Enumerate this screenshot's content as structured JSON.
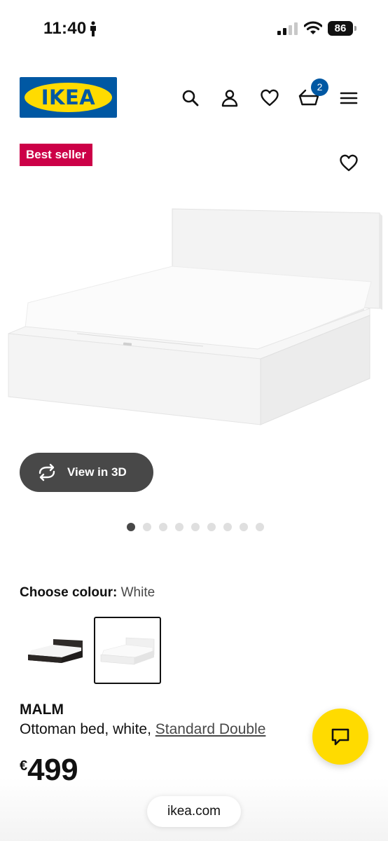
{
  "status_bar": {
    "time": "11:40",
    "battery": "86"
  },
  "header": {
    "logo_text": "IKEA",
    "cart_count": "2",
    "icons": [
      "search-icon",
      "account-icon",
      "heart-icon",
      "cart-icon",
      "menu-icon"
    ]
  },
  "product": {
    "badge": "Best seller",
    "view_3d_label": "View in 3D",
    "image_count": 9,
    "active_image": 1,
    "colour_label": "Choose colour:",
    "colour_value": "White",
    "colour_options": [
      "Black-brown",
      "White"
    ],
    "selected_colour_index": 1,
    "name": "MALM",
    "description_prefix": "Ottoman bed, white, ",
    "size_link": "Standard Double",
    "currency": "€",
    "price": "499"
  },
  "browser": {
    "url": "ikea.com"
  },
  "colors": {
    "ikea_blue": "#0058a3",
    "ikea_yellow": "#ffdb00",
    "badge_red": "#cc0047",
    "button_dark": "#484848"
  }
}
